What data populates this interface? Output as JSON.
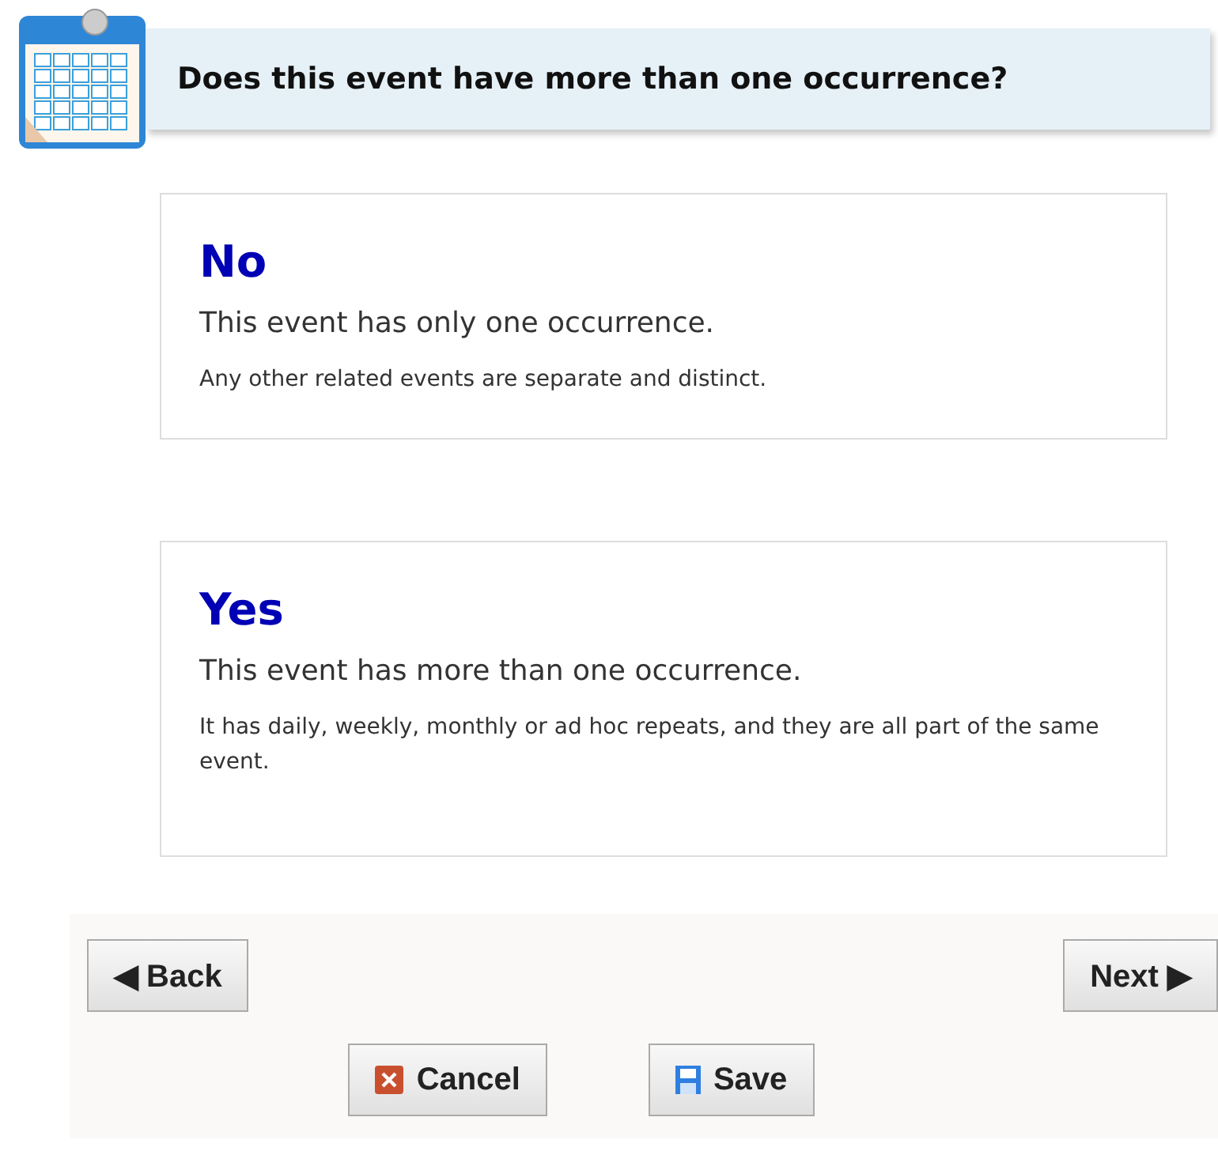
{
  "header": {
    "title": "Does this event have more than one occurrence?"
  },
  "options": [
    {
      "heading": "No",
      "summary": "This event has only one occurrence.",
      "detail": "Any other related events are separate and distinct."
    },
    {
      "heading": "Yes",
      "summary": "This event has more than one occurrence.",
      "detail": "It has daily, weekly, monthly or ad hoc repeats, and they are all part of the same event."
    }
  ],
  "nav": {
    "back": "◀ Back",
    "next": "Next ▶"
  },
  "actions": [
    {
      "kind": "cancel",
      "label": "Cancel"
    },
    {
      "kind": "save",
      "label": "Save"
    }
  ]
}
